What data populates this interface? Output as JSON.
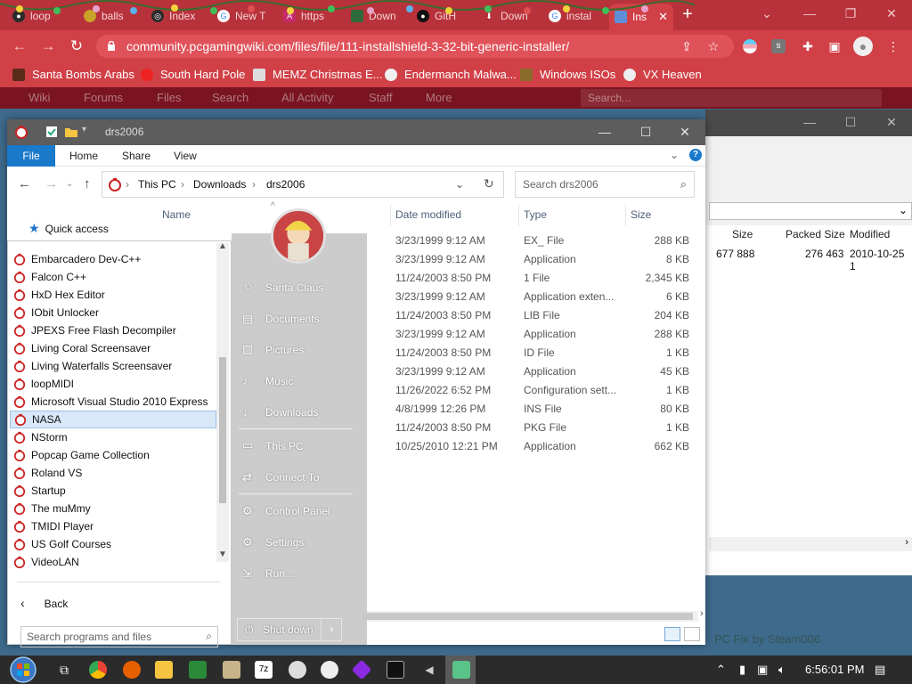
{
  "browser": {
    "tabs": [
      {
        "label": "loop"
      },
      {
        "label": "balls"
      },
      {
        "label": "Index"
      },
      {
        "label": "New T"
      },
      {
        "label": "https"
      },
      {
        "label": "Down"
      },
      {
        "label": "GitH"
      },
      {
        "label": "Down"
      },
      {
        "label": "instal"
      },
      {
        "label": "Ins"
      }
    ],
    "new_tab": "+",
    "url": "community.pcgamingwiki.com/files/file/111-installshield-3-32-bit-generic-installer/",
    "bookmarks": [
      {
        "label": "Santa Bombs Arabs"
      },
      {
        "label": "South Hard Pole"
      },
      {
        "label": "MEMZ Christmas E..."
      },
      {
        "label": "Endermanch Malwa..."
      },
      {
        "label": "Windows ISOs"
      },
      {
        "label": "VX Heaven"
      }
    ]
  },
  "site": {
    "nav": [
      "Wiki",
      "Forums",
      "Files",
      "Search",
      "All Activity",
      "Staff",
      "More"
    ],
    "search_placeholder": "Search..."
  },
  "zip": {
    "columns": [
      "Size",
      "Packed Size",
      "Modified"
    ],
    "row": {
      "size": "677 888",
      "packed": "276 463",
      "modified": "2010-10-25 1"
    },
    "footer": "PC Fix by Steam006"
  },
  "explorer": {
    "title": "drs2006",
    "ribbon": [
      "File",
      "Home",
      "Share",
      "View"
    ],
    "path": [
      "This PC",
      "Downloads",
      "drs2006"
    ],
    "search_placeholder": "Search drs2006",
    "columns": {
      "name": "Name",
      "date": "Date modified",
      "type": "Type",
      "size": "Size"
    },
    "quick_access": "Quick access",
    "files": [
      {
        "date": "3/23/1999 9:12 AM",
        "type": "EX_ File",
        "size": "288 KB"
      },
      {
        "date": "3/23/1999 9:12 AM",
        "type": "Application",
        "size": "8 KB"
      },
      {
        "date": "11/24/2003 8:50 PM",
        "type": "1 File",
        "size": "2,345 KB"
      },
      {
        "date": "3/23/1999 9:12 AM",
        "type": "Application exten...",
        "size": "6 KB"
      },
      {
        "date": "11/24/2003 8:50 PM",
        "type": "LIB File",
        "size": "204 KB"
      },
      {
        "date": "3/23/1999 9:12 AM",
        "type": "Application",
        "size": "288 KB"
      },
      {
        "date": "11/24/2003 8:50 PM",
        "type": "ID File",
        "size": "1 KB"
      },
      {
        "date": "3/23/1999 9:12 AM",
        "type": "Application",
        "size": "45 KB"
      },
      {
        "date": "11/26/2022 6:52 PM",
        "type": "Configuration sett...",
        "size": "1 KB"
      },
      {
        "date": "4/8/1999 12:26 PM",
        "type": "INS File",
        "size": "80 KB"
      },
      {
        "date": "11/24/2003 8:50 PM",
        "type": "PKG File",
        "size": "1 KB"
      },
      {
        "date": "10/25/2010 12:21 PM",
        "type": "Application",
        "size": "662 KB"
      }
    ]
  },
  "start_menu": {
    "programs": [
      "Embarcadero Dev-C++",
      "Falcon C++",
      "HxD Hex Editor",
      "IObit Unlocker",
      "JPEXS Free Flash Decompiler",
      "Living Coral Screensaver",
      "Living Waterfalls Screensaver",
      "loopMIDI",
      "Microsoft Visual Studio 2010 Express",
      "NASA",
      "NStorm",
      "Popcap Game Collection",
      "Roland VS",
      "Startup",
      "The muMmy",
      "TMIDI Player",
      "US Golf Courses",
      "VideoLAN"
    ],
    "selected_program": "NASA",
    "back": "Back",
    "search_placeholder": "Search programs and files",
    "right_links": [
      "Santa Claus",
      "Documents",
      "Pictures",
      "Music",
      "Downloads",
      "This PC",
      "Connect To",
      "Control Panel",
      "Settings",
      "Run..."
    ],
    "shutdown": "Shut down"
  },
  "taskbar": {
    "clock": "6:56:01 PM"
  }
}
